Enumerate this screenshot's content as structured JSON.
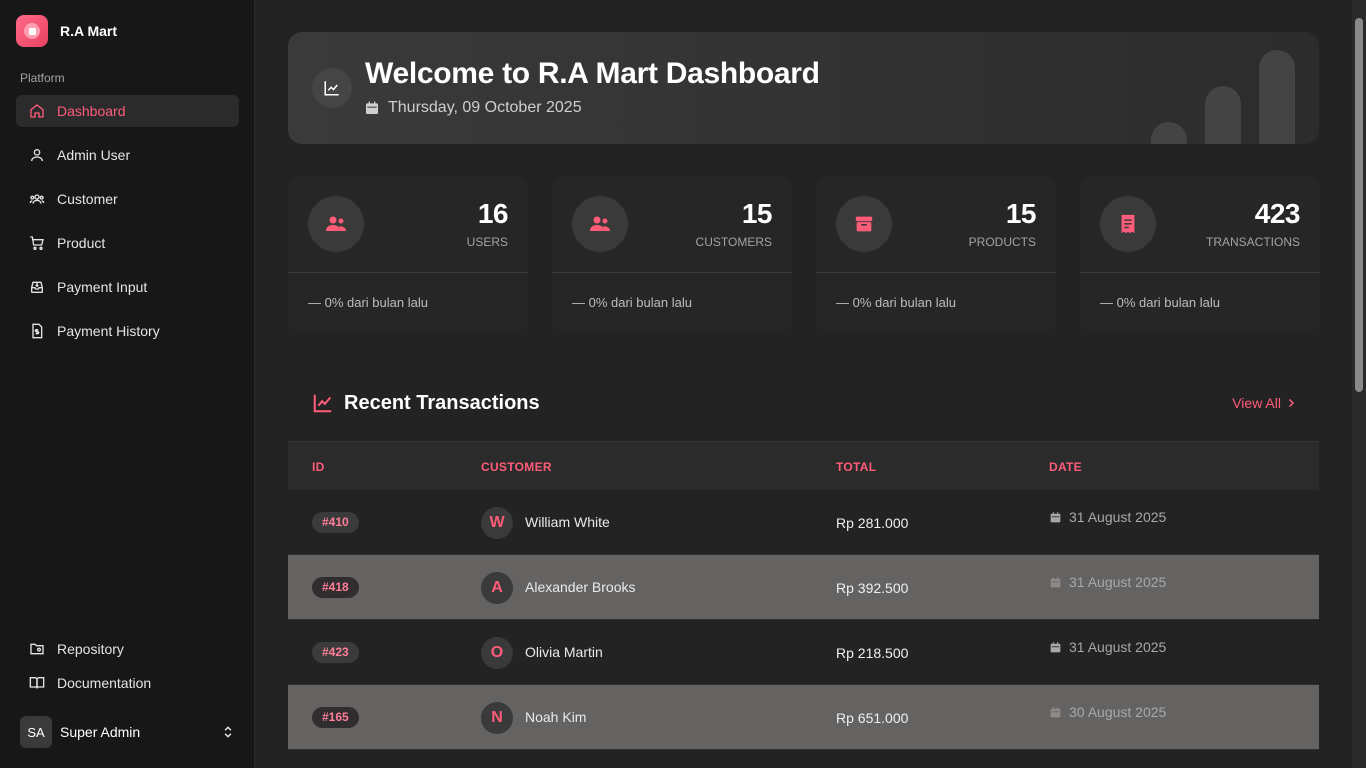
{
  "brand": {
    "name": "R.A Mart"
  },
  "sidebar": {
    "section_label": "Platform",
    "items": [
      {
        "label": "Dashboard",
        "icon": "home-icon",
        "active": true
      },
      {
        "label": "Admin User",
        "icon": "user-icon"
      },
      {
        "label": "Customer",
        "icon": "users-icon"
      },
      {
        "label": "Product",
        "icon": "cart-icon"
      },
      {
        "label": "Payment Input",
        "icon": "inbox-icon"
      },
      {
        "label": "Payment History",
        "icon": "receipt-icon"
      }
    ],
    "bottom_items": [
      {
        "label": "Repository",
        "icon": "folder-git-icon"
      },
      {
        "label": "Documentation",
        "icon": "book-icon"
      }
    ],
    "user": {
      "initials": "SA",
      "name": "Super Admin"
    }
  },
  "hero": {
    "title": "Welcome to R.A Mart Dashboard",
    "date": "Thursday, 09 October 2025"
  },
  "stats": [
    {
      "value": "16",
      "label": "USERS",
      "footer": "— 0% dari bulan lalu",
      "icon": "users-icon"
    },
    {
      "value": "15",
      "label": "CUSTOMERS",
      "footer": "— 0% dari bulan lalu",
      "icon": "users-icon"
    },
    {
      "value": "15",
      "label": "PRODUCTS",
      "footer": "— 0% dari bulan lalu",
      "icon": "box-icon"
    },
    {
      "value": "423",
      "label": "TRANSACTIONS",
      "footer": "— 0% dari bulan lalu",
      "icon": "receipt-icon"
    }
  ],
  "transactions": {
    "title": "Recent Transactions",
    "view_all": "View All",
    "columns": [
      "ID",
      "CUSTOMER",
      "TOTAL",
      "DATE"
    ],
    "rows": [
      {
        "id": "#410",
        "initial": "W",
        "customer": "William White",
        "total": "Rp 281.000",
        "date": "31 August 2025"
      },
      {
        "id": "#418",
        "initial": "A",
        "customer": "Alexander Brooks",
        "total": "Rp 392.500",
        "date": "31 August 2025"
      },
      {
        "id": "#423",
        "initial": "O",
        "customer": "Olivia Martin",
        "total": "Rp 218.500",
        "date": "31 August 2025"
      },
      {
        "id": "#165",
        "initial": "N",
        "customer": "Noah Kim",
        "total": "Rp 651.000",
        "date": "30 August 2025"
      }
    ]
  },
  "colors": {
    "accent": "#ff5c7a",
    "background": "#232323",
    "sidebar": "#171717"
  }
}
